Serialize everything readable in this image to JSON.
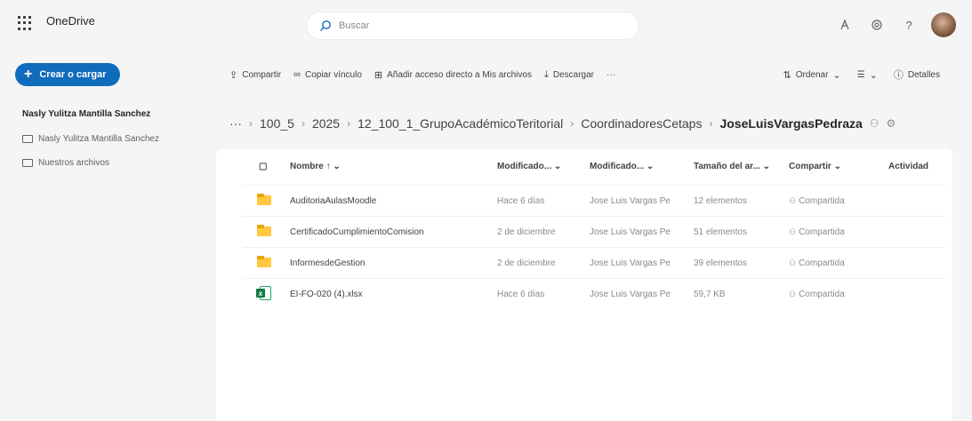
{
  "header": {
    "app_name": "OneDrive",
    "search_placeholder": "Buscar",
    "icons": [
      "waffle-icon",
      "premium-icon",
      "settings-icon",
      "help-icon",
      "avatar"
    ]
  },
  "sidebar": {
    "create_button": "Crear o cargar",
    "owner_name": "Nasly Yulitza Mantilla Sanchez",
    "items": [
      {
        "label": "Nasly Yulitza Mantilla Sanchez",
        "icon": "folder-icon"
      },
      {
        "label": "Nuestros archivos",
        "icon": "shared-folder-icon"
      }
    ]
  },
  "commandbar": {
    "share": "Compartir",
    "copy_link": "Copiar vínculo",
    "add_shortcut": "Añadir acceso directo a Mis archivos",
    "download": "Descargar",
    "more": "···",
    "sort": "Ordenar",
    "view": "☰",
    "details": "Detalles"
  },
  "breadcrumb": {
    "ellipsis": "···",
    "items": [
      "100_5",
      "2025",
      "12_100_1_GrupoAcadémicoTeritorial",
      "CoordinadoresCetaps"
    ],
    "current": "JoseLuisVargasPedraza"
  },
  "table": {
    "columns": [
      "Nombre",
      "Modificado...",
      "Modificado...",
      "Tamaño del ar...",
      "Compartir",
      "Actividad"
    ],
    "rows": [
      {
        "name": "AuditoriaAulasMoodle",
        "type": "folder",
        "modified": "Hace 6 días",
        "modified_by": "Jose Luis Vargas Pe",
        "size": "12 elementos",
        "sharing": "Compartida"
      },
      {
        "name": "CertificadoCumplimientoComision",
        "type": "folder",
        "modified": "2 de diciembre",
        "modified_by": "Jose Luis Vargas Pe",
        "size": "51 elementos",
        "sharing": "Compartida"
      },
      {
        "name": "InformesdeGestion",
        "type": "folder",
        "modified": "2 de diciembre",
        "modified_by": "Jose Luis Vargas Pe",
        "size": "39 elementos",
        "sharing": "Compartida"
      },
      {
        "name": "EI-FO-020 (4).xlsx",
        "type": "excel",
        "modified": "Hace 6 días",
        "modified_by": "Jose Luis Vargas Pe",
        "size": "59,7 KB",
        "sharing": "Compartida"
      }
    ]
  }
}
